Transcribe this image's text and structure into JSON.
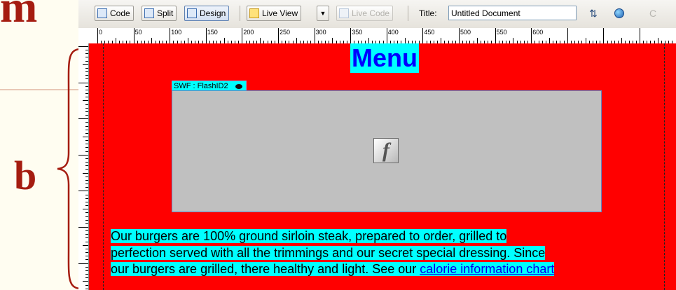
{
  "slide": {
    "top_letter": "m",
    "label": "b"
  },
  "toolbar": {
    "code_label": "Code",
    "split_label": "Split",
    "design_label": "Design",
    "live_view_label": "Live View",
    "live_code_label": "Live Code",
    "title_label": "Title:",
    "title_value": "Untitled Document"
  },
  "ruler": {
    "ticks": [
      "0",
      "50",
      "100",
      "150",
      "200",
      "250",
      "300",
      "350",
      "400",
      "450",
      "500",
      "550",
      "600"
    ]
  },
  "page": {
    "heading": "Menu",
    "swf_label": "SWF : FlashID2",
    "flash_glyph": "f",
    "paragraph_lines": [
      "Our burgers are 100% ground sirloin steak, prepared to order, grilled to",
      "perfection served with all the trimmings and our secret special dressing. Since",
      "our burgers are grilled, there healthy and light. See our "
    ],
    "link_text": "calorie information chart"
  },
  "colors": {
    "canvas_bg": "#ff0000",
    "highlight": "#00ffff",
    "heading_text": "#0000ff",
    "swf_bg": "#c0c0c0",
    "slide_accent": "#a51c10"
  }
}
